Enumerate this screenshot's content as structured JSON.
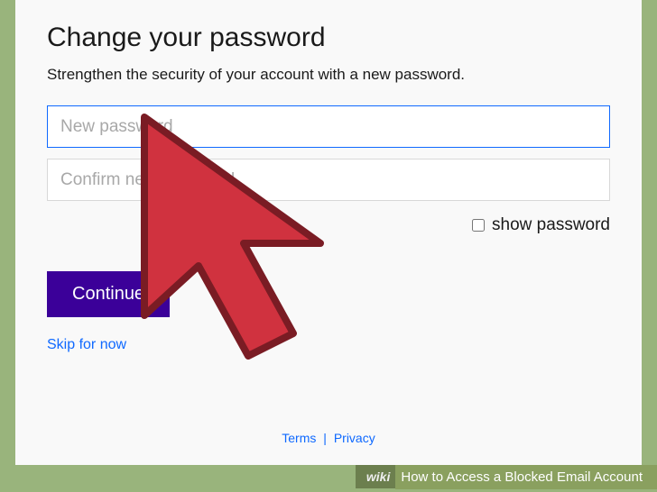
{
  "page": {
    "title": "Change your password",
    "subtitle": "Strengthen the security of your account with a new password."
  },
  "inputs": {
    "new_password_placeholder": "New password",
    "confirm_password_placeholder": "Confirm new password"
  },
  "show_password": {
    "label": "show password"
  },
  "buttons": {
    "continue": "Continue",
    "skip": "Skip for now"
  },
  "footer": {
    "terms": "Terms",
    "privacy": "Privacy"
  },
  "caption": {
    "prefix": "wikiHow",
    "prefix_bold_start": "wiki",
    "prefix_rest": "How to Access a Blocked Email Account"
  }
}
